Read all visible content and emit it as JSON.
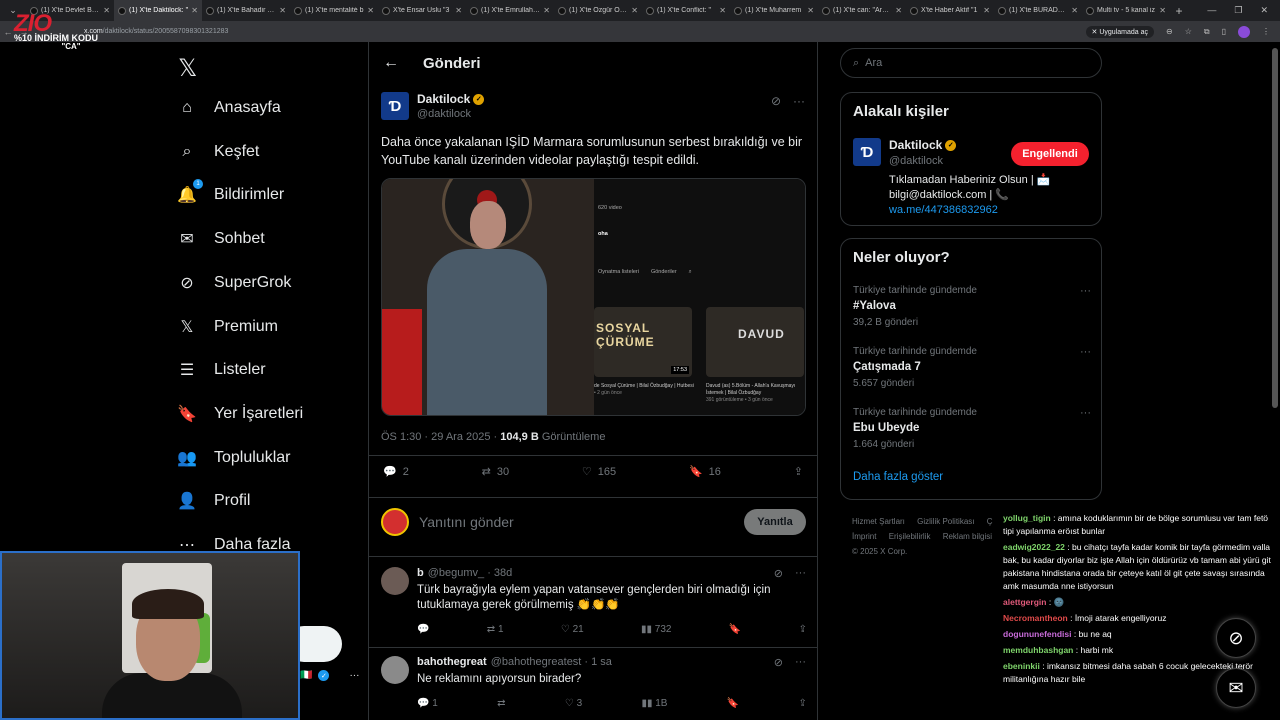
{
  "browser": {
    "tabs": [
      {
        "label": "(1) X'te Devlet Bahç"
      },
      {
        "label": "(1) X'te Daktilock: \"",
        "active": true
      },
      {
        "label": "(1) X'te Bahadir Teki"
      },
      {
        "label": "(1) X'te mentalité b"
      },
      {
        "label": "X'te Ensar Uslu \"3"
      },
      {
        "label": "(1) X'te Emrullah Er"
      },
      {
        "label": "(1) X'te Özgür Özel"
      },
      {
        "label": "(1) X'te Conflict: \""
      },
      {
        "label": "(1) X'te Muharrem"
      },
      {
        "label": "(1) X'te can: \"Arkad"
      },
      {
        "label": "X'te Haber Aktif \"1"
      },
      {
        "label": "(1) X'te BURADA W"
      },
      {
        "label": "Multi tv - 5 kanal iz"
      }
    ],
    "url_host": "x.com",
    "url_path": "/daktilock/status/2005587098301321283",
    "app_chip": "Uygulamada aç"
  },
  "overlay": {
    "logo": "ZIO",
    "promo": "%10 İNDİRİM KODU",
    "code": "\"CA\""
  },
  "nav": {
    "items": [
      {
        "label": "Anasayfa",
        "icon": "home-icon"
      },
      {
        "label": "Keşfet",
        "icon": "search-icon"
      },
      {
        "label": "Bildirimler",
        "icon": "bell-icon",
        "badge": "1"
      },
      {
        "label": "Sohbet",
        "icon": "mail-icon"
      },
      {
        "label": "SuperGrok",
        "icon": "grok-icon"
      },
      {
        "label": "Premium",
        "icon": "x-icon"
      },
      {
        "label": "Listeler",
        "icon": "list-icon"
      },
      {
        "label": "Yer İşaretleri",
        "icon": "bookmark-icon"
      },
      {
        "label": "Topluluklar",
        "icon": "people-icon"
      },
      {
        "label": "Profil",
        "icon": "person-icon"
      },
      {
        "label": "Daha fazla",
        "icon": "more-circle-icon"
      }
    ],
    "post_button": "a"
  },
  "header": {
    "title": "Gönderi"
  },
  "post": {
    "name": "Daktilock",
    "handle": "@daktilock",
    "text": "Daha önce yakalanan IŞİD Marmara sorumlusunun serbest bırakıldığı ve bir YouTube kanalı üzerinden videolar paylaştığı tespit edildi.",
    "media": {
      "video_count": "620 video",
      "channel": "oha",
      "tabs": [
        "Oynatma listeleri",
        "Gönderiler"
      ],
      "thumb1_title": "SOSYAL ÇÜRÜME",
      "thumb1_duration": "17:53",
      "thumb1_caption": "de Sosyal Çürüme | Bilal Özbudğay | Hutbesi",
      "thumb1_sub": "• 2 gün önce",
      "thumb2_title": "DAVUD",
      "thumb2_caption": "Davud (as) 5.Bölüm - Allah'a Kavuşmayı İstemek | Bilal Özbudğay",
      "thumb2_sub": "391 görüntüleme • 3 gün önce"
    },
    "time": "ÖS 1:30 · 29 Ara 2025 ·",
    "views": "104,9 B",
    "views_label": "Görüntüleme",
    "stats": {
      "replies": "2",
      "reposts": "30",
      "likes": "165",
      "bookmarks": "16"
    }
  },
  "reply": {
    "placeholder": "Yanıtını gönder",
    "button": "Yanıtla"
  },
  "comments": [
    {
      "name": "b",
      "handle": "@begumv_ · 38d",
      "text": "Türk bayrağıyla eylem yapan vatansever gençlerden biri olmadığı için tutuklamaya gerek görülmemiş 👏👏👏",
      "replies": "",
      "reposts": "1",
      "likes": "21",
      "views": "732"
    },
    {
      "name": "bahothegreat",
      "handle": "@bahothegreatest · 1 sa",
      "text": "Ne reklamını apıyorsun birader?",
      "replies": "1",
      "reposts": "",
      "likes": "3",
      "views": "1B"
    }
  ],
  "search": {
    "placeholder": "Ara"
  },
  "related": {
    "title": "Alakalı kişiler",
    "name": "Daktilock",
    "handle": "@daktilock",
    "bio": "Tıklamadan Haberiniz Olsun | 📩 bilgi@daktilock.com | 📞",
    "link": "wa.me/447386832962",
    "button": "Engellendi"
  },
  "trends": {
    "title": "Neler oluyor?",
    "items": [
      {
        "context": "Türkiye tarihinde gündemde",
        "topic": "#Yalova",
        "count": "39,2 B gönderi"
      },
      {
        "context": "Türkiye tarihinde gündemde",
        "topic": "Çatışmada 7",
        "count": "5.657 gönderi"
      },
      {
        "context": "Türkiye tarihinde gündemde",
        "topic": "Ebu Ubeyde",
        "count": "1.664 gönderi"
      }
    ],
    "show_more": "Daha fazla göster"
  },
  "footer": {
    "links": [
      "Hizmet Şartları",
      "Gizlilik Politikası",
      "Ç",
      "İmprint",
      "Erişilebilirlik",
      "Reklam bilgisi"
    ],
    "copy": "© 2025 X Corp."
  },
  "chat": [
    {
      "user": "yollug_tigin",
      "color": "#7fd46b",
      "msg": ": amına koduklarımın bir de bölge sorumlusu var tam fetö tipi yapılanma eröıst bunlar"
    },
    {
      "user": "eadwig2022_22",
      "color": "#7fd46b",
      "msg": ": bu cihatçı tayfa kadar komik bir tayfa görmedim valla bak, bu kadar diyorlar biz işte Allah için öldürürüz vb tamam abi yürü git pakistana hindistana orada bir çeteye katıl öl git çete savaşı sırasında amk masumda nne istiyorsun"
    },
    {
      "user": "alettgergin",
      "color": "#e05a7a",
      "msg": ": 🌚"
    },
    {
      "user": "Necromantheon",
      "color": "#e04a4a",
      "msg": ": İmoji atarak engelliyoruz"
    },
    {
      "user": "dogununefendisi",
      "color": "#c86bd9",
      "msg": ": bu ne aq"
    },
    {
      "user": "memduhbashgan",
      "color": "#7fd46b",
      "msg": ": harbi mk"
    },
    {
      "user": "ebeninkii",
      "color": "#7fd46b",
      "msg": ": imkansız bitmesi daha sabah 6 cocuk gelecekteki terör militanlığına hazır bile"
    }
  ],
  "colors": {
    "accent": "#1d9bf0",
    "block": "#f4212e",
    "verified": "#e0a200",
    "webcam_border": "#2b6fc9"
  }
}
